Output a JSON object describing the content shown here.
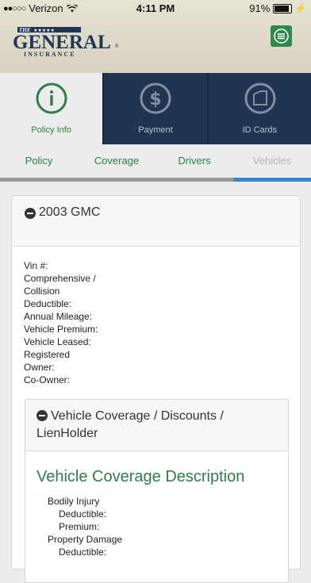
{
  "status_bar": {
    "signal": "●●○○○",
    "carrier": "Verizon",
    "time": "4:11 PM",
    "battery": "91%",
    "battery_level": 0.91
  },
  "header": {
    "logo_the": "THE",
    "logo_stars": "★★★★★",
    "logo_main": "GENERAL",
    "logo_sub": "INSURANCE",
    "logo_reg": "®",
    "brand_color": "#2e8a4c"
  },
  "tabs": [
    {
      "label": "Policy Info",
      "icon": "info-icon",
      "active": true
    },
    {
      "label": "Payment",
      "icon": "dollar-icon",
      "active": false
    },
    {
      "label": "ID Cards",
      "icon": "id-card-icon",
      "active": false
    }
  ],
  "subnav": [
    {
      "label": "Policy"
    },
    {
      "label": "Coverage"
    },
    {
      "label": "Drivers"
    },
    {
      "label": "Vehicles"
    }
  ],
  "progress": {
    "position": 4,
    "of": 4
  },
  "vehicle": {
    "title": "2003 GMC",
    "fields": [
      "Vin #:",
      "Comprehensive /",
      "Collision",
      "Deductible:",
      "Annual Mileage:",
      "Vehicle Premium:",
      "Vehicle Leased:",
      "Registered",
      "Owner:",
      "Co-Owner:"
    ]
  },
  "coverage_section": {
    "header": "Vehicle Coverage / Discounts / LienHolder",
    "title": "Vehicle Coverage Description",
    "items": [
      {
        "label": "Bodily Injury",
        "indent": false
      },
      {
        "label": "Deductible:",
        "indent": true
      },
      {
        "label": "Premium:",
        "indent": true
      },
      {
        "label": "Property Damage",
        "indent": false
      },
      {
        "label": "Deductible:",
        "indent": true
      }
    ]
  },
  "colors": {
    "navy": "#1f3552",
    "green": "#2e7d4a",
    "accent_blue": "#3a87c7"
  }
}
